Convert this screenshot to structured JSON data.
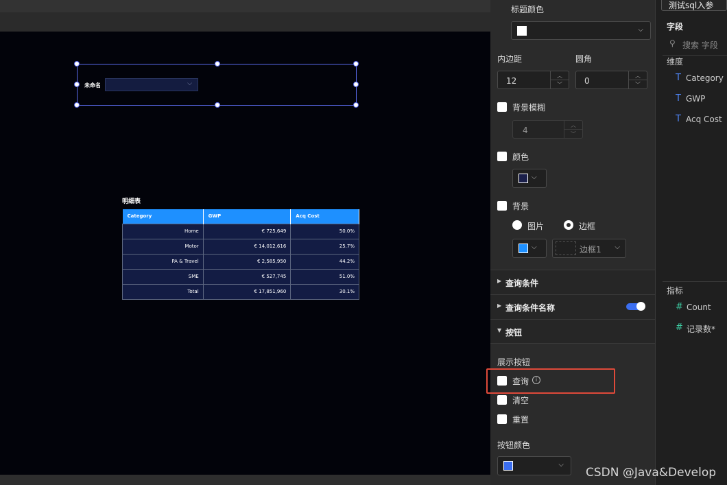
{
  "canvas": {
    "query_widget": {
      "label": "未命名"
    },
    "detail_table": {
      "title": "明细表",
      "columns": [
        "Category",
        "GWP",
        "Acq Cost"
      ],
      "rows": [
        [
          "Home",
          "€ 725,649",
          "50.0%"
        ],
        [
          "Motor",
          "€ 14,012,616",
          "25.7%"
        ],
        [
          "PA & Travel",
          "€ 2,585,950",
          "44.2%"
        ],
        [
          "SME",
          "€ 527,745",
          "51.0%"
        ],
        [
          "Total",
          "€ 17,851,960",
          "30.1%"
        ]
      ]
    }
  },
  "props": {
    "title_color_label": "标题颜色",
    "padding_label": "内边距",
    "padding_value": "12",
    "radius_label": "圆角",
    "radius_value": "0",
    "bg_blur_label": "背景模糊",
    "bg_blur_value": "4",
    "color_label": "颜色",
    "background_label": "背景",
    "radio_image": "图片",
    "radio_border": "边框",
    "border_select": "边框1",
    "section_query_condition": "查询条件",
    "section_query_name": "查询条件名称",
    "section_buttons": "按钮",
    "show_buttons_label": "展示按钮",
    "btn_query": "查询",
    "btn_clear": "清空",
    "btn_reset": "重置",
    "button_color_label": "按钮颜色",
    "colors": {
      "title": "#ffffff",
      "font": "#1a1f4a",
      "bg": "#1e90ff",
      "button": "#3b6ef0",
      "highlight": "#e04a3a"
    }
  },
  "fields": {
    "dataset": "测试sql入参",
    "heading": "字段",
    "search_placeholder": "搜索 字段",
    "dimensions_label": "维度",
    "dimensions": [
      "Category",
      "GWP",
      "Acq Cost"
    ],
    "metrics_label": "指标",
    "metrics": [
      "Count",
      "记录数*"
    ]
  },
  "watermark": "CSDN @Java&Develop"
}
